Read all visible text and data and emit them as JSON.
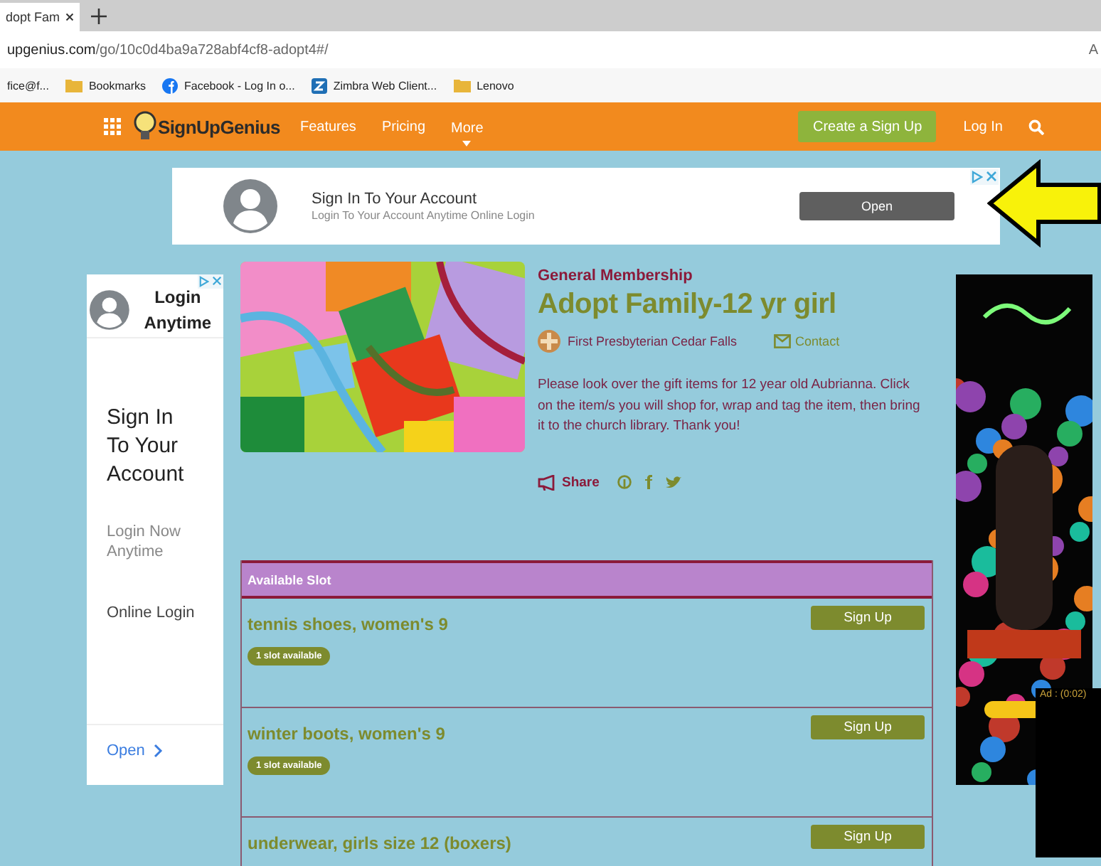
{
  "browser": {
    "tab_title": "dopt Fam",
    "address": {
      "host": "upgenius.com",
      "path": "/go/10c0d4ba9a728abf4cf8-adopt4#/"
    },
    "address_edge": "A",
    "bookmarks": [
      {
        "label": "fice@f...",
        "kind": "text"
      },
      {
        "label": "Bookmarks",
        "kind": "folder"
      },
      {
        "label": "Facebook - Log In o...",
        "kind": "facebook"
      },
      {
        "label": "Zimbra Web Client...",
        "kind": "zimbra"
      },
      {
        "label": "Lenovo",
        "kind": "folder"
      }
    ]
  },
  "nav": {
    "logo": "SignUpGenius",
    "links": [
      {
        "label": "Features",
        "dropdown": false
      },
      {
        "label": "Pricing",
        "dropdown": false
      },
      {
        "label": "More",
        "dropdown": true
      }
    ],
    "create_button": "Create a Sign Up",
    "login": "Log In"
  },
  "top_ad": {
    "title": "Sign In To Your Account",
    "subtitle": "Login To Your Account Anytime Online Login",
    "button": "Open"
  },
  "side_ad": {
    "header": "Login Anytime",
    "headline": "Sign In To Your Account",
    "line_1": "Login Now Anytime",
    "line_2": "Online Login",
    "link": "Open"
  },
  "signup": {
    "category": "General Membership",
    "title": "Adopt Family-12 yr girl",
    "organizer": "First Presbyterian Cedar Falls",
    "contact": "Contact",
    "description": "Please look over the gift items for 12 year old Aubrianna. Click on the item/s you will shop for, wrap and tag the item, then bring it to the church library. Thank you!",
    "share": "Share"
  },
  "slots": {
    "header": "Available Slot",
    "rows": [
      {
        "item": "tennis shoes, women's 9",
        "badge": "1 slot available",
        "button": "Sign Up"
      },
      {
        "item": "winter boots, women's 9",
        "badge": "1 slot available",
        "button": "Sign Up"
      },
      {
        "item": "underwear, girls size 12 (boxers)",
        "button": "Sign Up"
      }
    ]
  },
  "video_ad": {
    "timer": "Ad : (0:02)"
  }
}
